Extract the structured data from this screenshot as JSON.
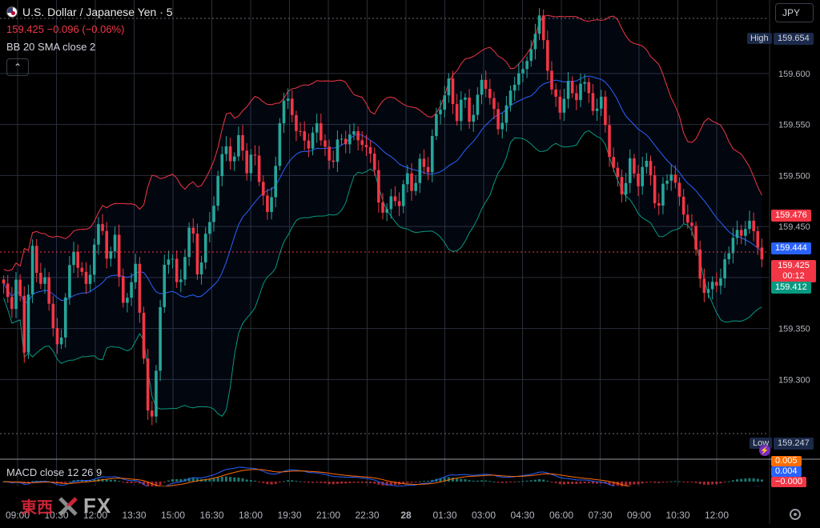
{
  "header": {
    "symbol_title": "U.S. Dollar / Japanese Yen · 5",
    "quote": "159.425  −0.096 (−0.06%)",
    "bb_indicator": "BB 20 SMA close 2",
    "currency_button": "JPY",
    "collapse_glyph": "⌃"
  },
  "macd_indicator": "MACD close 12 26 9",
  "price_axis": {
    "ticks": [
      "159.600",
      "159.550",
      "159.500",
      "159.450",
      "159.400",
      "159.350",
      "159.300"
    ],
    "tick_values": [
      159.6,
      159.55,
      159.5,
      159.45,
      159.4,
      159.35,
      159.3
    ],
    "high_tag": "High",
    "high_value": "159.654",
    "low_tag": "Low",
    "low_value": "159.247",
    "bb_upper_value": "159.476",
    "bb_basis_value": "159.444",
    "last_price_value": "159.425",
    "countdown": "00:12",
    "bb_lower_value": "159.412"
  },
  "macd_axis": {
    "values": [
      "0.005",
      "0.004",
      "−0.000"
    ]
  },
  "time_axis": {
    "labels": [
      "09:00",
      "10:30",
      "12:00",
      "13:30",
      "15:00",
      "16:30",
      "18:00",
      "19:30",
      "21:00",
      "22:30",
      "28",
      "01:30",
      "03:00",
      "04:30",
      "06:00",
      "07:30",
      "09:00",
      "10:30",
      "12:00"
    ]
  },
  "watermark": {
    "cn": "東西",
    "fx": "FX"
  },
  "icons": {
    "settings": "gear-icon",
    "countdown": "lightning-icon",
    "flag": "usd-jpy-flag-icon"
  },
  "colors": {
    "up": "#26a69a",
    "down": "#f23645",
    "bb_band": "#f23645",
    "bb_basis": "#2962ff",
    "bb_lower": "#089981",
    "macd": "#2962ff",
    "signal": "#ff6d00"
  },
  "chart_data": {
    "type": "candlestick",
    "interval": "5",
    "ylim": [
      159.247,
      159.654
    ],
    "series_colors": {
      "up": "#26a69a",
      "down": "#f23645"
    },
    "path": [
      159.39,
      159.36,
      159.42,
      159.32,
      159.44,
      159.38,
      159.41,
      159.35,
      159.33,
      159.38,
      159.43,
      159.41,
      159.39,
      159.43,
      159.45,
      159.42,
      159.44,
      159.38,
      159.37,
      159.42,
      159.33,
      159.25,
      159.31,
      159.41,
      159.43,
      159.39,
      159.42,
      159.45,
      159.4,
      159.44,
      159.47,
      159.5,
      159.53,
      159.51,
      159.55,
      159.5,
      159.52,
      159.49,
      159.46,
      159.51,
      159.56,
      159.58,
      159.54,
      159.55,
      159.52,
      159.55,
      159.53,
      159.51,
      159.54,
      159.52,
      159.55,
      159.53,
      159.54,
      159.51,
      159.47,
      159.46,
      159.49,
      159.47,
      159.5,
      159.48,
      159.52,
      159.51,
      159.55,
      159.57,
      159.59,
      159.56,
      159.58,
      159.55,
      159.57,
      159.6,
      159.58,
      159.54,
      159.56,
      159.58,
      159.61,
      159.6,
      159.63,
      159.65,
      159.62,
      159.58,
      159.56,
      159.59,
      159.57,
      159.6,
      159.58,
      159.56,
      159.57,
      159.53,
      159.5,
      159.48,
      159.51,
      159.49,
      159.52,
      159.5,
      159.46,
      159.49,
      159.51,
      159.48,
      159.46,
      159.44,
      159.41,
      159.38,
      159.4,
      159.39,
      159.42,
      159.45,
      159.44,
      159.46,
      159.43,
      159.425
    ]
  }
}
